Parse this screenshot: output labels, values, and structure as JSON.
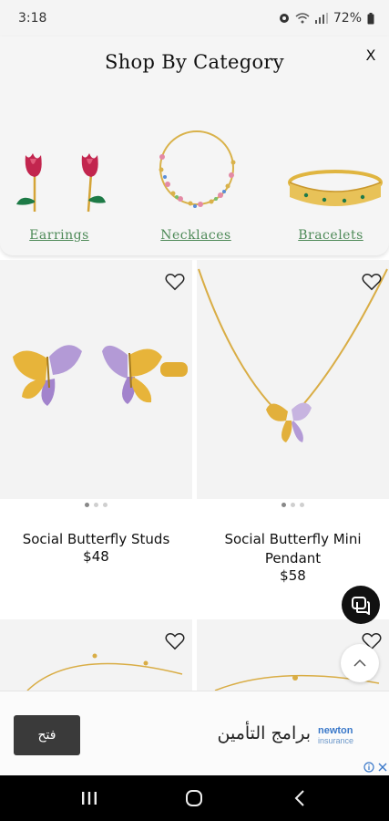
{
  "status_bar": {
    "time": "3:18",
    "battery": "72%"
  },
  "category_sheet": {
    "title": "Shop By Category",
    "close_label": "X",
    "categories": [
      {
        "label": "Earrings"
      },
      {
        "label": "Necklaces"
      },
      {
        "label": "Bracelets"
      }
    ]
  },
  "products": [
    {
      "name": "Social Butterfly Studs",
      "price": "$48"
    },
    {
      "name": "Social Butterfly Mini Pendant",
      "price": "$58"
    },
    {
      "name": "",
      "price": ""
    },
    {
      "name": "",
      "price": ""
    }
  ],
  "ad": {
    "button_label": "فتح",
    "text": "برامج التأمين",
    "brand": "newton",
    "brand_sub": "insurance"
  },
  "icons": {
    "heart": "heart-outline-icon",
    "chat": "chat-icon",
    "scroll_top": "chevron-up-icon",
    "close": "close-icon",
    "nav": [
      "recent-apps-icon",
      "home-icon",
      "back-icon"
    ]
  },
  "colors": {
    "category_link": "#4e8a58",
    "gold": "#e3b23c",
    "accent_dark": "#111111"
  }
}
